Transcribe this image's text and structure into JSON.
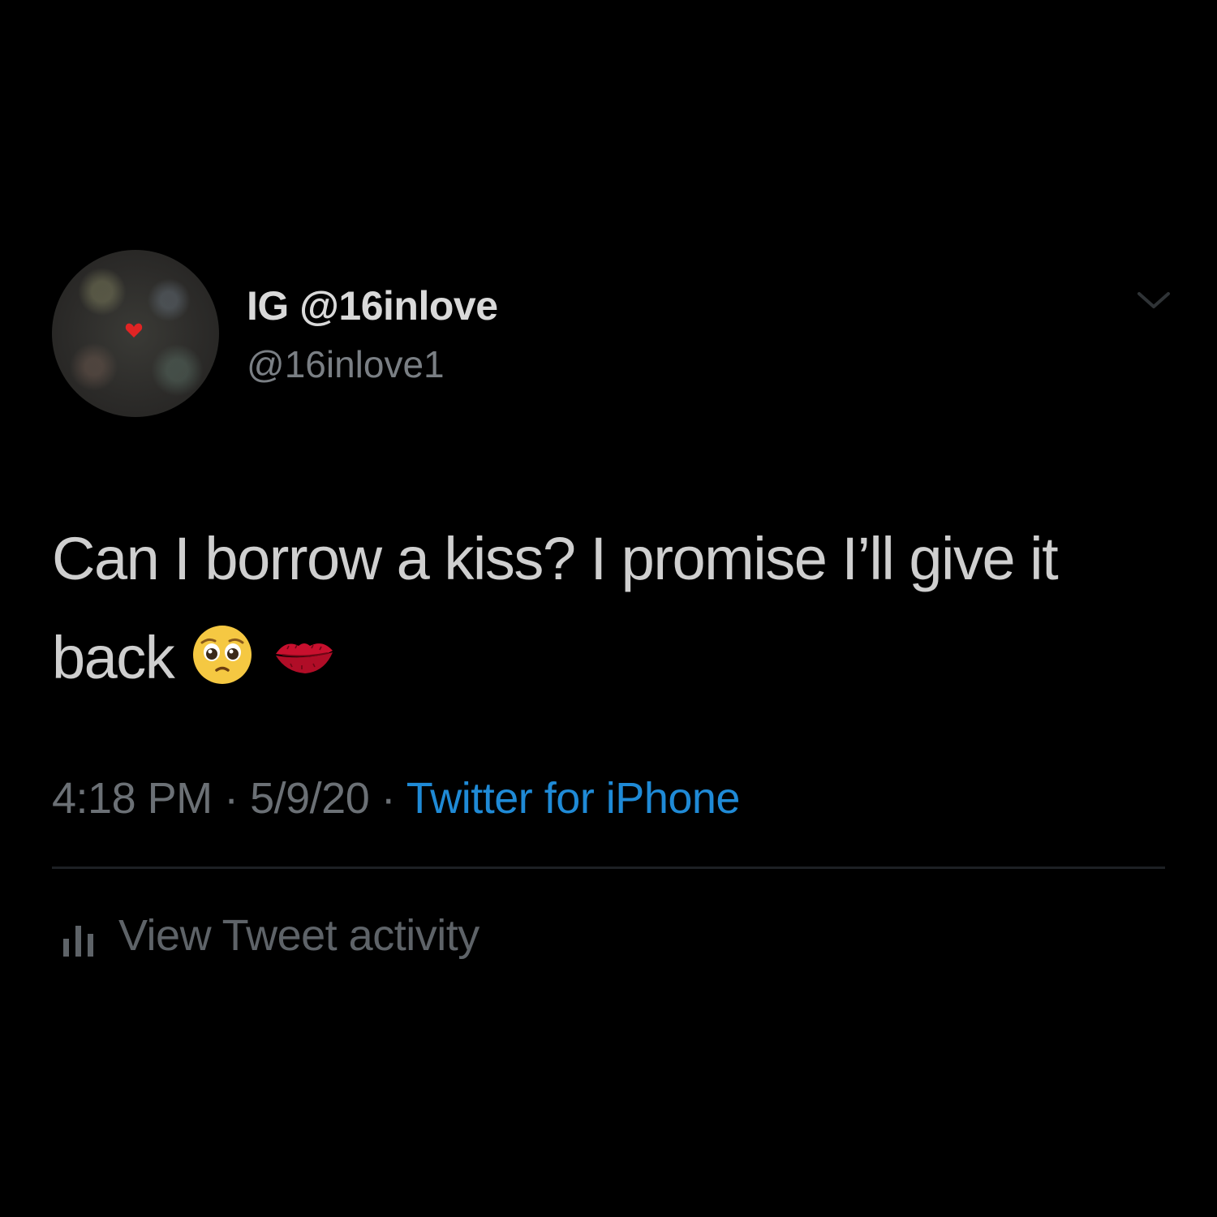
{
  "tweet": {
    "display_name": "IG @16inlove",
    "handle": "@16inlove1",
    "text_main": "Can I borrow a kiss? I promise I’ll give it back",
    "emojis": [
      "pleading-face-emoji",
      "kiss-mark-emoji"
    ],
    "time": "4:18 PM",
    "separator1": " · ",
    "date": "5/9/20",
    "separator2": " · ",
    "source": "Twitter for iPhone",
    "activity_label": "View Tweet activity"
  },
  "colors": {
    "background": "#000000",
    "link_blue": "#1f8ad6",
    "primary_text": "#d9d9d9",
    "secondary_text": "#6b7075"
  }
}
